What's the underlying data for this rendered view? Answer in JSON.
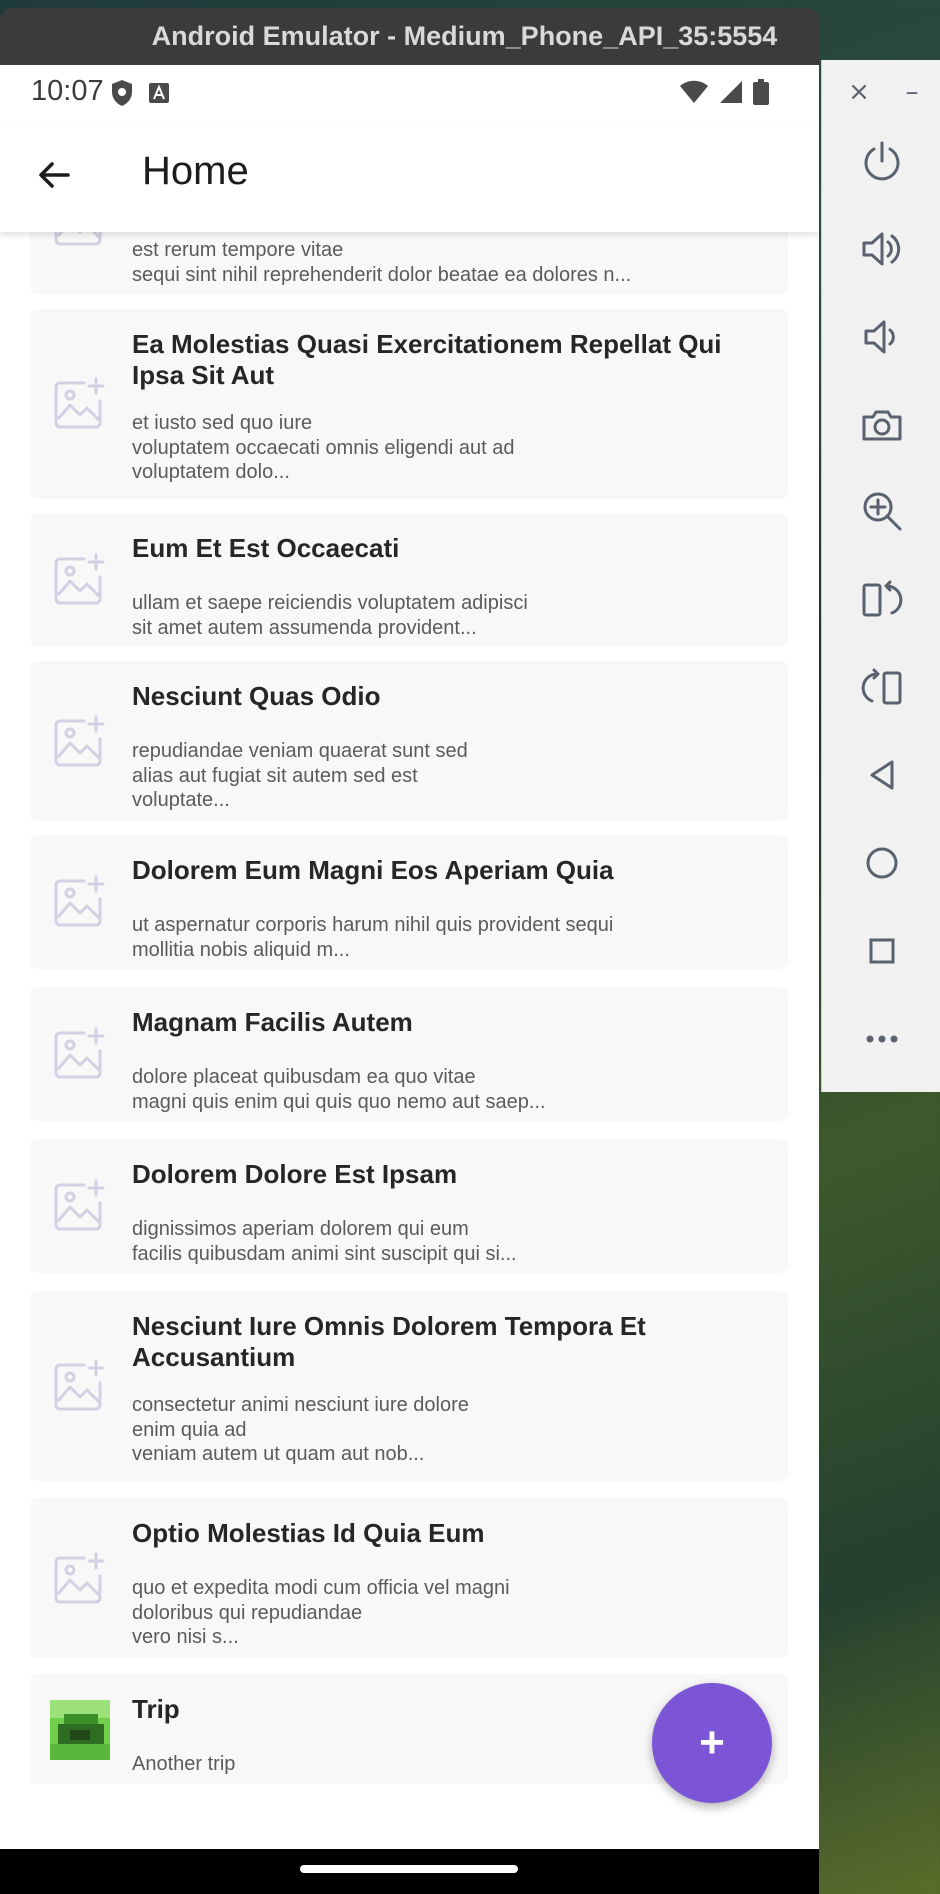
{
  "emulator": {
    "window_title": "Android Emulator - Medium_Phone_API_35:5554",
    "toolbar": {
      "close_label": "×",
      "minimize_label": "–",
      "buttons": [
        "power-icon",
        "volume-up-icon",
        "volume-down-icon",
        "camera-icon",
        "zoom-icon",
        "rotate-left-icon",
        "rotate-right-icon",
        "back-icon",
        "home-icon",
        "overview-icon",
        "more-icon"
      ]
    }
  },
  "status_bar": {
    "time": "10:07"
  },
  "app_bar": {
    "title": "Home"
  },
  "items": [
    {
      "title": "",
      "body": "est rerum tempore vitae\nsequi sint nihil reprehenderit dolor beatae ea dolores n...",
      "thumb": "placeholder"
    },
    {
      "title": "Ea Molestias Quasi Exercitationem Repellat Qui Ipsa Sit Aut",
      "body": "et iusto sed quo iure\nvoluptatem occaecati omnis eligendi aut ad\nvoluptatem dolo...",
      "thumb": "placeholder"
    },
    {
      "title": "Eum Et Est Occaecati",
      "body": "ullam et saepe reiciendis voluptatem adipisci\nsit amet autem assumenda provident...",
      "thumb": "placeholder"
    },
    {
      "title": "Nesciunt Quas Odio",
      "body": "repudiandae veniam quaerat sunt sed\nalias aut fugiat sit autem sed est\nvoluptate...",
      "thumb": "placeholder"
    },
    {
      "title": "Dolorem Eum Magni Eos Aperiam Quia",
      "body": "ut aspernatur corporis harum nihil quis provident sequi\nmollitia nobis aliquid m...",
      "thumb": "placeholder"
    },
    {
      "title": "Magnam Facilis Autem",
      "body": "dolore placeat quibusdam ea quo vitae\nmagni quis enim qui quis quo nemo aut saep...",
      "thumb": "placeholder"
    },
    {
      "title": "Dolorem Dolore Est Ipsam",
      "body": "dignissimos aperiam dolorem qui eum\nfacilis quibusdam animi sint suscipit qui si...",
      "thumb": "placeholder"
    },
    {
      "title": "Nesciunt Iure Omnis Dolorem Tempora Et Accusantium",
      "body": "consectetur animi nesciunt iure dolore\nenim quia ad\nveniam autem ut quam aut nob...",
      "thumb": "placeholder"
    },
    {
      "title": "Optio Molestias Id Quia Eum",
      "body": "quo et expedita modi cum officia vel magni\ndoloribus qui repudiandae\nvero nisi s...",
      "thumb": "placeholder"
    },
    {
      "title": "Trip",
      "body": "Another trip",
      "thumb": "photo"
    }
  ],
  "fab": {
    "label": "+"
  },
  "colors": {
    "fab": "#7b55d6",
    "card_background": "#f8f8f8",
    "title_bar": "#3b3b3b"
  }
}
